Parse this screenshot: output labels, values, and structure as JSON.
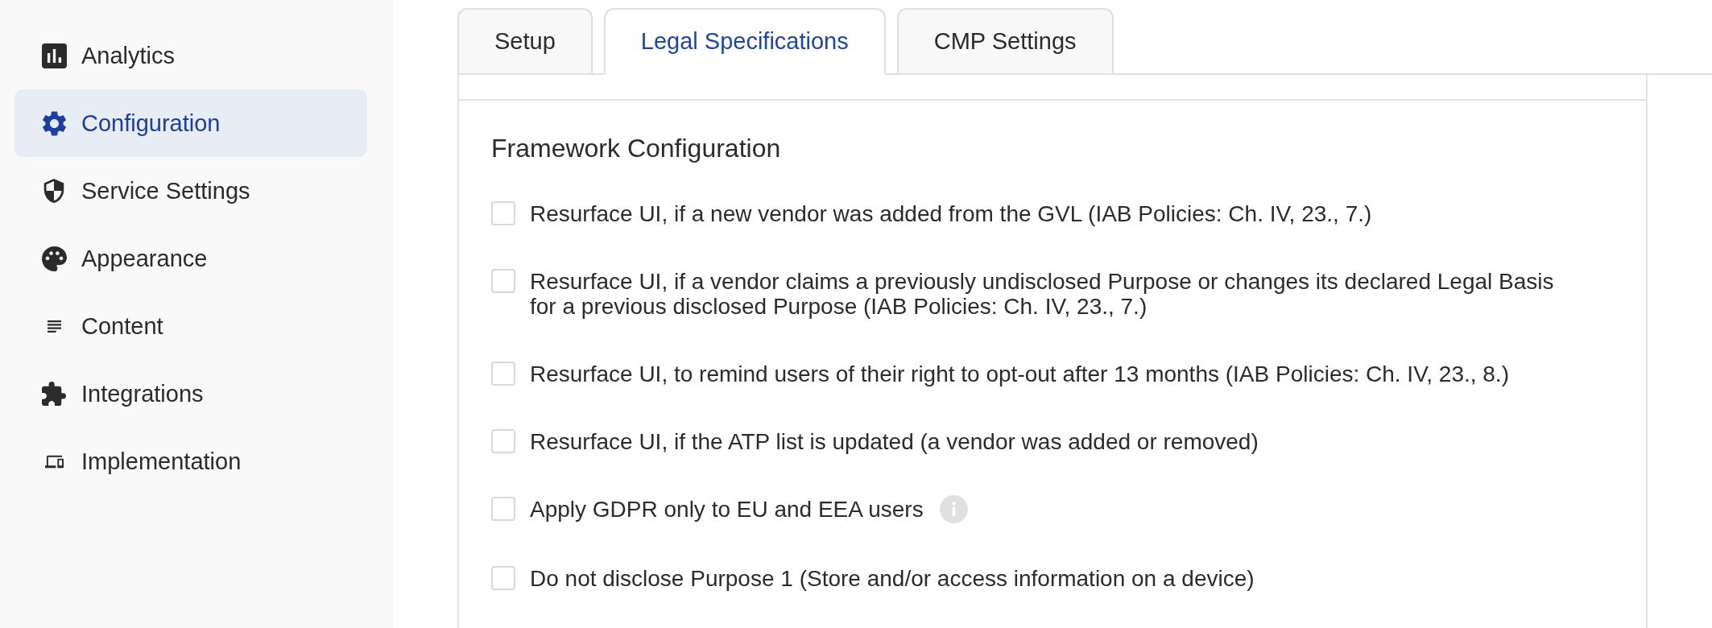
{
  "sidebar": {
    "items": [
      {
        "label": "Analytics",
        "selected": false
      },
      {
        "label": "Configuration",
        "selected": true
      },
      {
        "label": "Service Settings",
        "selected": false
      },
      {
        "label": "Appearance",
        "selected": false
      },
      {
        "label": "Content",
        "selected": false
      },
      {
        "label": "Integrations",
        "selected": false
      },
      {
        "label": "Implementation",
        "selected": false
      }
    ]
  },
  "tabs": [
    {
      "label": "Setup",
      "selected": false
    },
    {
      "label": "Legal Specifications",
      "selected": true
    },
    {
      "label": "CMP Settings",
      "selected": false
    }
  ],
  "section": {
    "title": "Framework Configuration",
    "options": [
      {
        "label": "Resurface UI, if a new vendor was added from the GVL (IAB Policies: Ch. IV, 23., 7.)",
        "checked": false,
        "info": false
      },
      {
        "label": "Resurface UI, if a vendor claims a previously undisclosed Purpose or changes its declared Legal Basis for a previous disclosed Purpose (IAB Policies: Ch. IV, 23., 7.)",
        "checked": false,
        "info": false
      },
      {
        "label": "Resurface UI, to remind users of their right to opt-out after 13 months (IAB Policies: Ch. IV, 23., 8.)",
        "checked": false,
        "info": false
      },
      {
        "label": "Resurface UI, if the ATP list is updated (a vendor was added or removed)",
        "checked": false,
        "info": false
      },
      {
        "label": "Apply GDPR only to EU and EEA users",
        "checked": false,
        "info": true
      },
      {
        "label": "Do not disclose Purpose 1 (Store and/or access information on a device)",
        "checked": false,
        "info": false
      }
    ]
  }
}
